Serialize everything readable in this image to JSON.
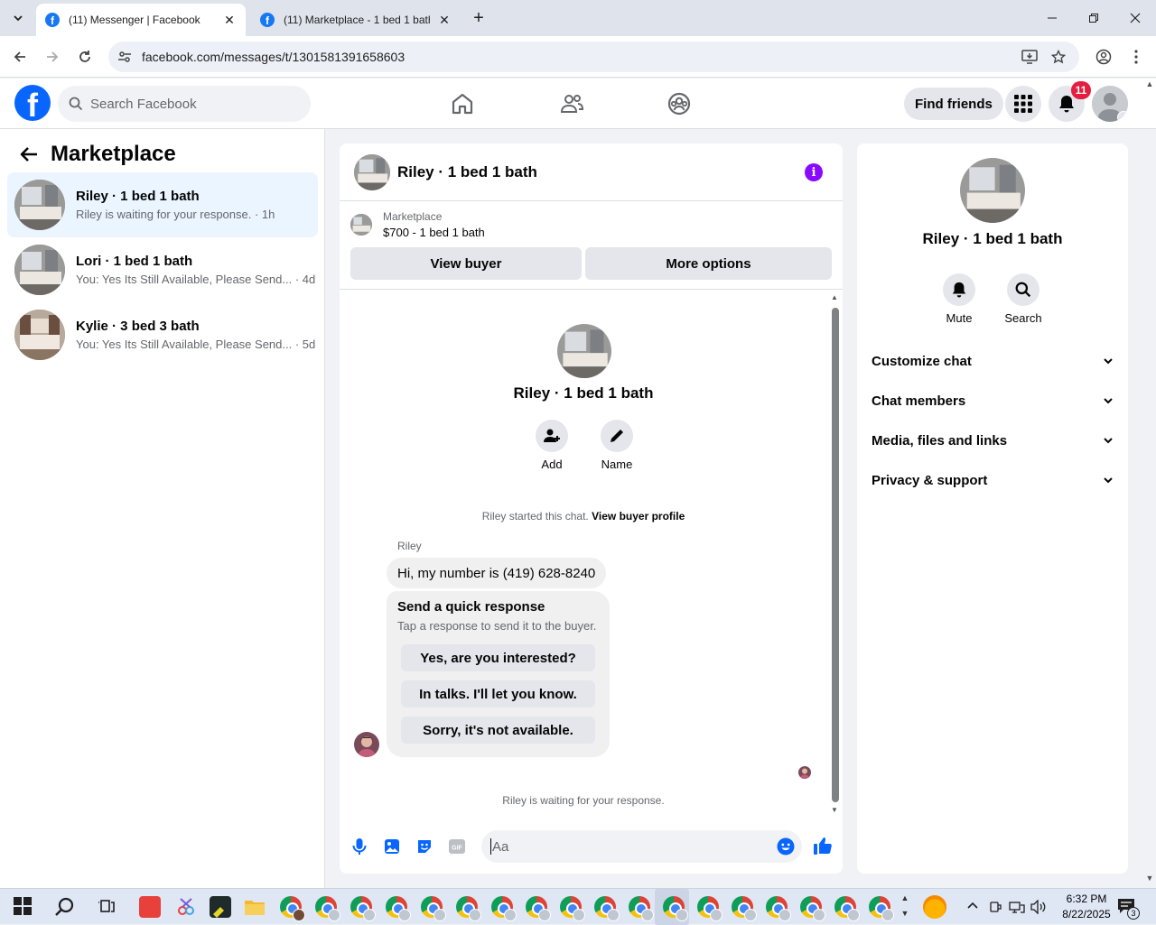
{
  "browser": {
    "tabs": [
      {
        "title": "(11) Messenger | Facebook",
        "active": true
      },
      {
        "title": "(11) Marketplace - 1 bed 1 bath",
        "active": false
      }
    ],
    "url": "facebook.com/messages/t/1301581391658603",
    "new_tab_icon": "plus-icon",
    "window_controls": [
      "minimize-icon",
      "restore-icon",
      "close-icon"
    ]
  },
  "fb_header": {
    "logo": "f",
    "search_placeholder": "Search Facebook",
    "nav_icons": [
      "home-icon",
      "friends-icon",
      "groups-icon"
    ],
    "find_friends_label": "Find friends",
    "notification_count": "11"
  },
  "sidebar": {
    "title": "Marketplace",
    "conversations": [
      {
        "name": "Riley · 1 bed 1 bath",
        "preview": "Riley is waiting for your response. · 1h",
        "selected": true
      },
      {
        "name": "Lori · 1 bed 1 bath",
        "preview": "You: Yes Its Still Available, Please Send... · 4d",
        "selected": false
      },
      {
        "name": "Kylie · 3 bed 3 bath",
        "preview": "You: Yes Its Still Available, Please Send... · 5d",
        "selected": false
      }
    ]
  },
  "chat": {
    "title": "Riley · 1 bed 1 bath",
    "marketplace_label": "Marketplace",
    "listing": "$700 - 1 bed 1 bath",
    "view_buyer_label": "View buyer",
    "more_options_label": "More options",
    "profile_name": "Riley · 1 bed 1 bath",
    "add_label": "Add",
    "name_label": "Name",
    "started_text": "Riley started this chat.",
    "view_buyer_profile_label": "View buyer profile",
    "sender_name": "Riley",
    "message": "Hi, my number is (419) 628-8240",
    "quick_response": {
      "heading": "Send a quick response",
      "subtext": "Tap a response to send it to the buyer.",
      "options": [
        "Yes, are you interested?",
        "In talks. I'll let you know.",
        "Sorry, it's not available."
      ]
    },
    "waiting_text": "Riley is waiting for your response.",
    "input_placeholder": "Aa",
    "accent_color": "#0866ff"
  },
  "right_panel": {
    "name": "Riley · 1 bed 1 bath",
    "mute_label": "Mute",
    "search_label": "Search",
    "sections": [
      "Customize chat",
      "Chat members",
      "Media, files and links",
      "Privacy & support"
    ]
  },
  "taskbar": {
    "time": "6:32 PM",
    "date": "8/22/2025",
    "notification_count": "3"
  }
}
